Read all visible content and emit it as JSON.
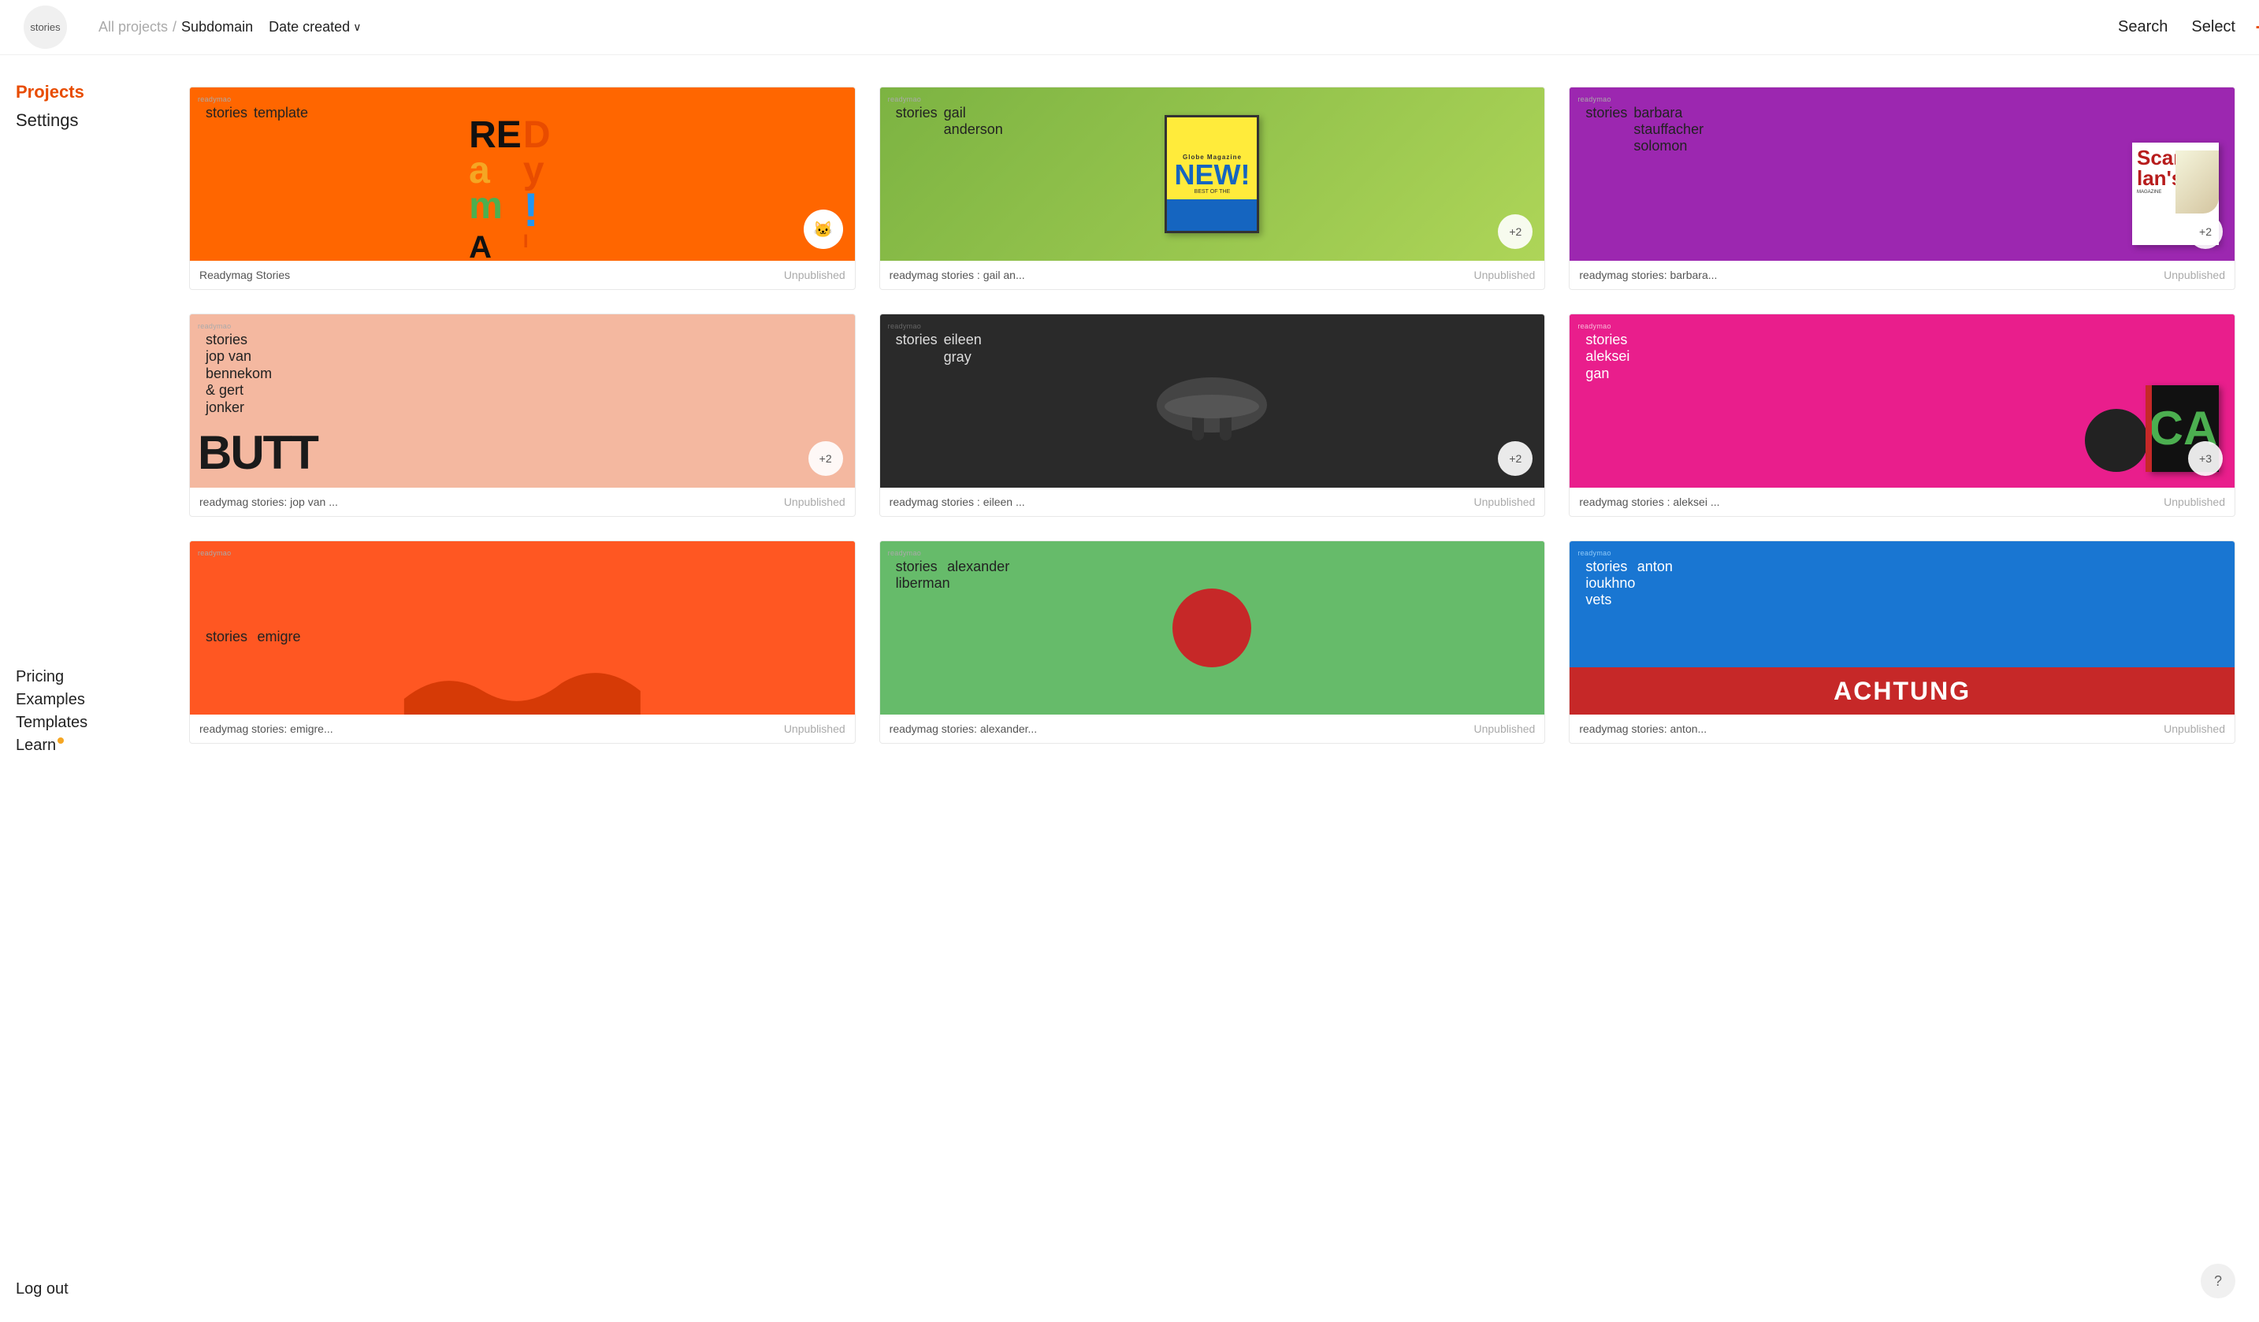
{
  "header": {
    "logo_text": "stories",
    "logo_plus": "+",
    "breadcrumb_all": "All projects",
    "breadcrumb_sep": "/",
    "breadcrumb_current": "Subdomain",
    "sort_label": "Date created",
    "sort_arrow": "∨",
    "search_label": "Search",
    "select_label": "Select"
  },
  "sidebar": {
    "nav_top": [
      {
        "label": "Projects",
        "active": true
      },
      {
        "label": "Settings",
        "active": false
      }
    ],
    "nav_bottom": [
      {
        "label": "Pricing"
      },
      {
        "label": "Examples"
      },
      {
        "label": "Templates"
      },
      {
        "label": "Learn",
        "has_dot": true
      }
    ],
    "logout_label": "Log out"
  },
  "projects": [
    {
      "id": 1,
      "thumb_label": "readymao",
      "stories_text": "stories",
      "title": "template",
      "name": "Readymag Stories",
      "status": "Unpublished",
      "extra_count": null,
      "bg_type": "1"
    },
    {
      "id": 2,
      "thumb_label": "readymao",
      "stories_text": "stories",
      "title": "gail anderson",
      "name": "readymag stories : gail an...",
      "status": "Unpublished",
      "extra_count": "+2",
      "bg_type": "2"
    },
    {
      "id": 3,
      "thumb_label": "readymao",
      "stories_text": "stories",
      "title": "barbara stauffacher solomon",
      "name": "readymag stories: barbara...",
      "status": "Unpublished",
      "extra_count": "+2",
      "bg_type": "3"
    },
    {
      "id": 4,
      "thumb_label": "readymao",
      "stories_text": "stories",
      "title": "jop van bennekom & gert jonker",
      "name": "readymag stories: jop van ...",
      "status": "Unpublished",
      "extra_count": "+2",
      "bg_type": "4"
    },
    {
      "id": 5,
      "thumb_label": "readymao",
      "stories_text": "stories",
      "title": "eileen gray",
      "name": "readymag stories : eileen ...",
      "status": "Unpublished",
      "extra_count": "+2",
      "bg_type": "5"
    },
    {
      "id": 6,
      "thumb_label": "readymao",
      "stories_text": "stories",
      "title": "aleksei gan",
      "name": "readymag stories : aleksei ...",
      "status": "Unpublished",
      "extra_count": "+3",
      "bg_type": "6"
    },
    {
      "id": 7,
      "thumb_label": "readymao",
      "stories_text": "stories",
      "title": "emigre",
      "name": "readymag stories: emigre...",
      "status": "Unpublished",
      "extra_count": null,
      "bg_type": "7"
    },
    {
      "id": 8,
      "thumb_label": "readymao",
      "stories_text": "stories",
      "title": "alexander liberman",
      "name": "readymag stories: alexander...",
      "status": "Unpublished",
      "extra_count": null,
      "bg_type": "8"
    },
    {
      "id": 9,
      "thumb_label": "readymao",
      "stories_text": "stories",
      "title": "anton ioukhnovets",
      "name": "readymag stories: anton...",
      "status": "Unpublished",
      "extra_count": null,
      "bg_type": "9"
    }
  ],
  "help_label": "?"
}
